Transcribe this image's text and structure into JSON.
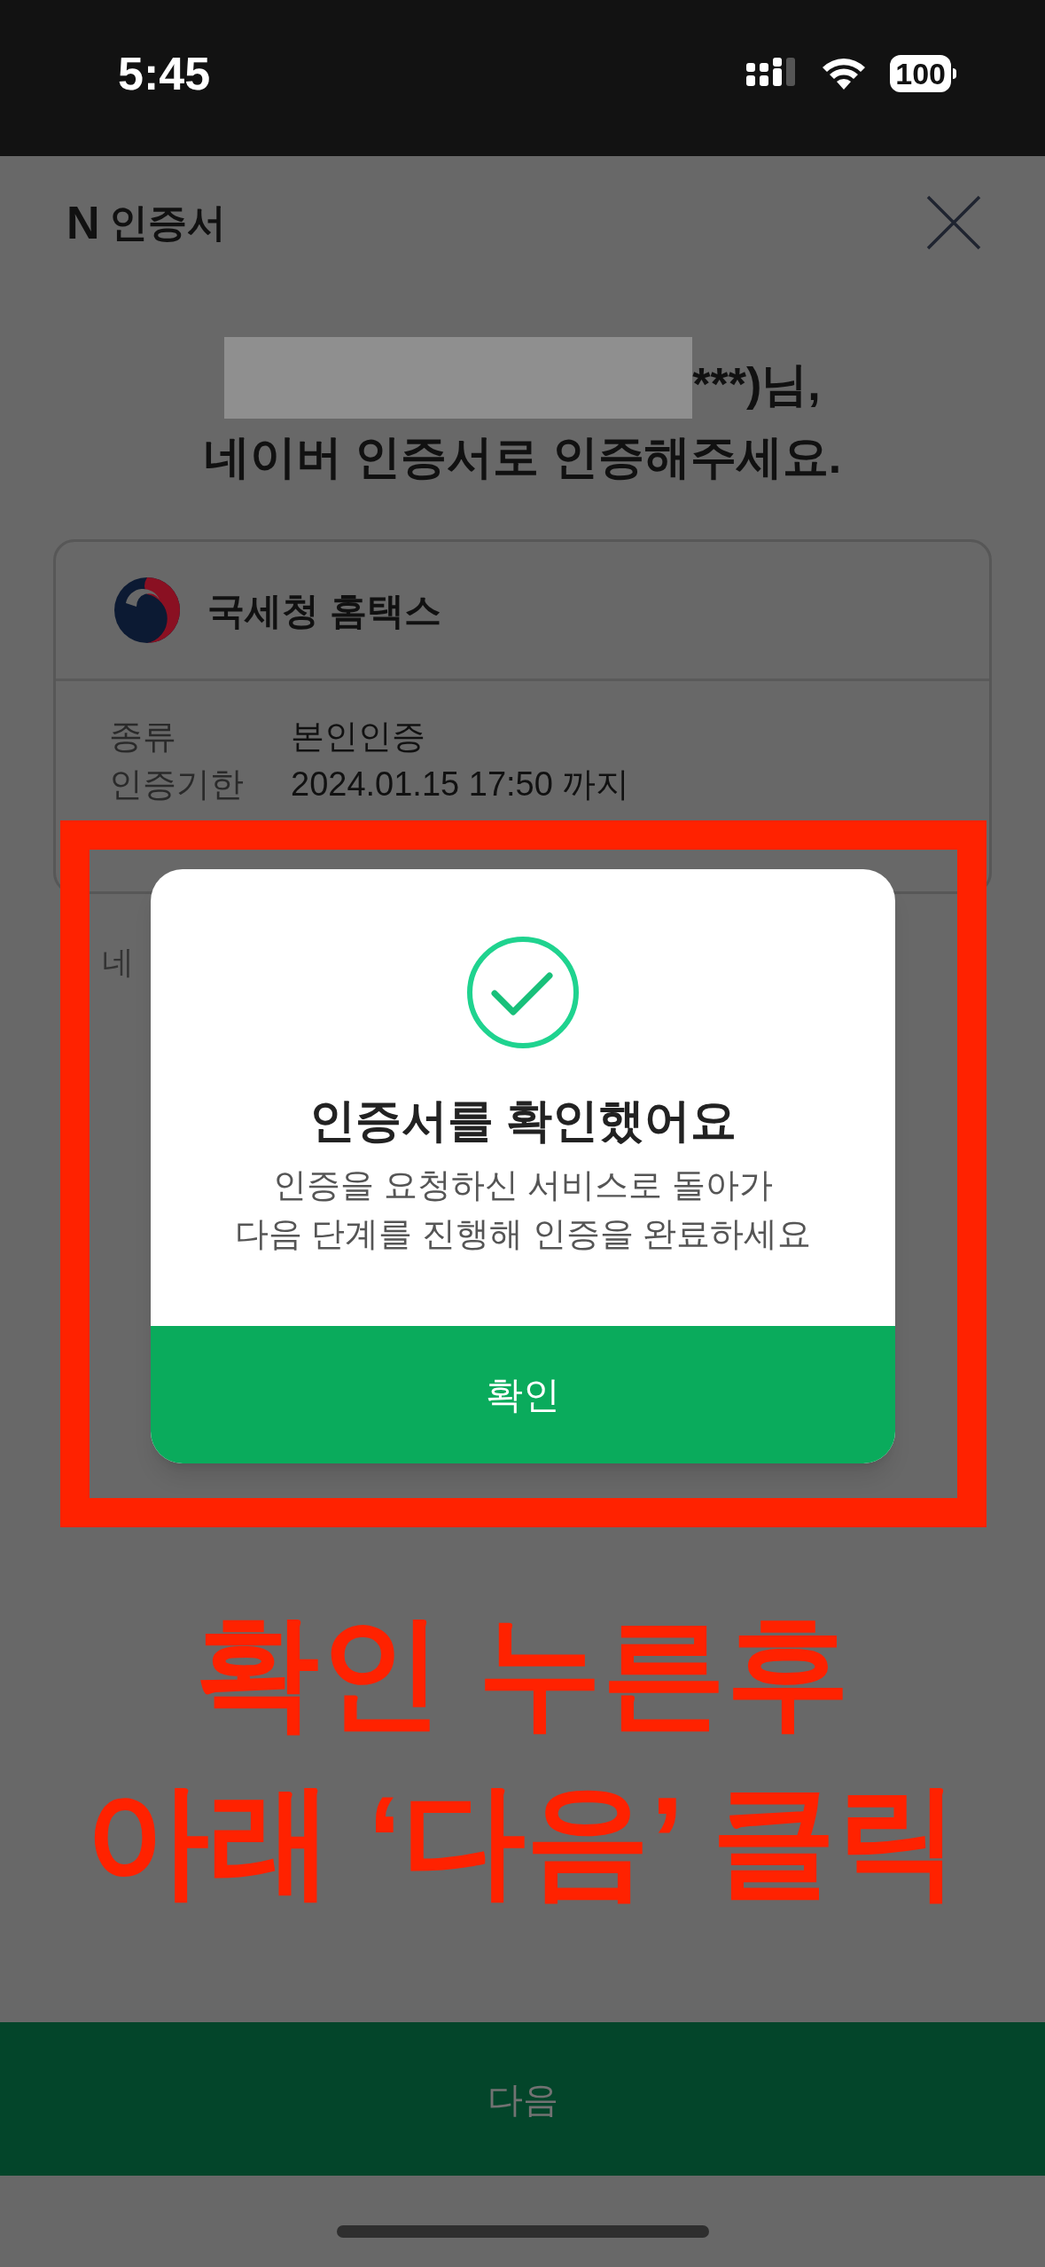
{
  "status_bar": {
    "time": "5:45",
    "battery": "100"
  },
  "header": {
    "logo": "N",
    "title": "인증서"
  },
  "greeting": {
    "line_1": "***)님,",
    "line_2": "네이버 인증서로 인증해주세요."
  },
  "service_card": {
    "name": "국세청 홈택스",
    "rows": [
      {
        "label": "종류",
        "value": "본인인증"
      },
      {
        "label": "인증기한",
        "value": "2024.01.15 17:50 까지"
      }
    ]
  },
  "notice": "네",
  "dialog": {
    "title": "인증서를 확인했어요",
    "message_lines": [
      "인증을 요청하신 서비스로 돌아가",
      "다음 단계를 진행해 인증을 완료하세요"
    ],
    "button": "확인"
  },
  "annotation": {
    "lines": [
      "확인 누른후",
      "아래 ‘다음’ 클릭"
    ]
  },
  "next_button": "다음"
}
